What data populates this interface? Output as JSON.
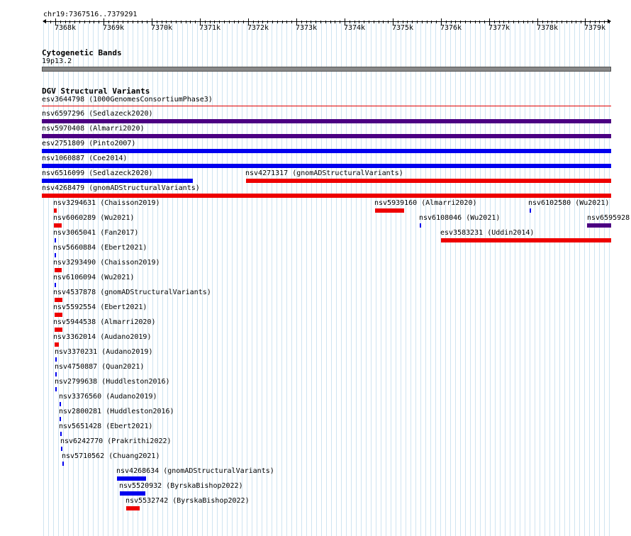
{
  "region_label": "chr19:7367516..7379291",
  "ruler_ticks": [
    "7368k",
    "7369k",
    "7370k",
    "7371k",
    "7372k",
    "7373k",
    "7374k",
    "7375k",
    "7376k",
    "7377k",
    "7378k",
    "7379k"
  ],
  "cytogenetic": {
    "title": "Cytogenetic Bands",
    "band": "19p13.2",
    "band_color": "#888888"
  },
  "dgv": {
    "title": "DGV Structural Variants",
    "features": [
      {
        "label": "esv3644798 (1000GenomesConsortiumPhase3)",
        "color": "#e00000"
      },
      {
        "label": "nsv6597296 (Sedlazeck2020)",
        "color": "#4b0082"
      },
      {
        "label": "nsv5970408 (Almarri2020)",
        "color": "#4b0082"
      },
      {
        "label": "esv2751809 (Pinto2007)",
        "color": "#0000ee"
      },
      {
        "label": "nsv1060887 (Coe2014)",
        "color": "#0000ee"
      },
      {
        "label": "nsv6516099 (Sedlazeck2020)",
        "color": "#0000ee"
      },
      {
        "label": "nsv4271317 (gnomADStructuralVariants)",
        "color": "#ee0000"
      },
      {
        "label": "nsv4268479 (gnomADStructuralVariants)",
        "color": "#ee0000"
      },
      {
        "label": "nsv3294631 (Chaisson2019)",
        "color": "#ee0000"
      },
      {
        "label": "nsv5939160 (Almarri2020)",
        "color": "#ee0000"
      },
      {
        "label": "nsv6102580 (Wu2021)",
        "color": "#0000ee"
      },
      {
        "label": "nsv6060289 (Wu2021)",
        "color": "#ee0000"
      },
      {
        "label": "nsv6108046 (Wu2021)",
        "color": "#0000ee"
      },
      {
        "label": "nsv6595928",
        "color": "#4b0082"
      },
      {
        "label": "nsv3065041 (Fan2017)",
        "color": "#0000ee"
      },
      {
        "label": "esv3583231 (Uddin2014)",
        "color": "#ee0000"
      },
      {
        "label": "nsv5660884 (Ebert2021)",
        "color": "#0000ee"
      },
      {
        "label": "nsv3293490 (Chaisson2019)",
        "color": "#ee0000"
      },
      {
        "label": "nsv6106094 (Wu2021)",
        "color": "#0000ee"
      },
      {
        "label": "nsv4537878 (gnomADStructuralVariants)",
        "color": "#ee0000"
      },
      {
        "label": "nsv5592554 (Ebert2021)",
        "color": "#ee0000"
      },
      {
        "label": "nsv5944538 (Almarri2020)",
        "color": "#ee0000"
      },
      {
        "label": "nsv3362014 (Audano2019)",
        "color": "#ee0000"
      },
      {
        "label": "nsv3370231 (Audano2019)",
        "color": "#0000ee"
      },
      {
        "label": "nsv4750887 (Quan2021)",
        "color": "#0000ee"
      },
      {
        "label": "nsv2799638 (Huddleston2016)",
        "color": "#0000ee"
      },
      {
        "label": "nsv3376560 (Audano2019)",
        "color": "#0000ee"
      },
      {
        "label": "nsv2800281 (Huddleston2016)",
        "color": "#0000ee"
      },
      {
        "label": "nsv5651428 (Ebert2021)",
        "color": "#0000ee"
      },
      {
        "label": "nsv6242770 (Prakrithi2022)",
        "color": "#0000ee"
      },
      {
        "label": "nsv5710562 (Chuang2021)",
        "color": "#0000ee"
      },
      {
        "label": "nsv4268634 (gnomADStructuralVariants)",
        "color": "#0000ee"
      },
      {
        "label": "nsv5520932 (ByrskaBishop2022)",
        "color": "#0000ee"
      },
      {
        "label": "nsv5532742 (ByrskaBishop2022)",
        "color": "#ee0000"
      }
    ]
  }
}
